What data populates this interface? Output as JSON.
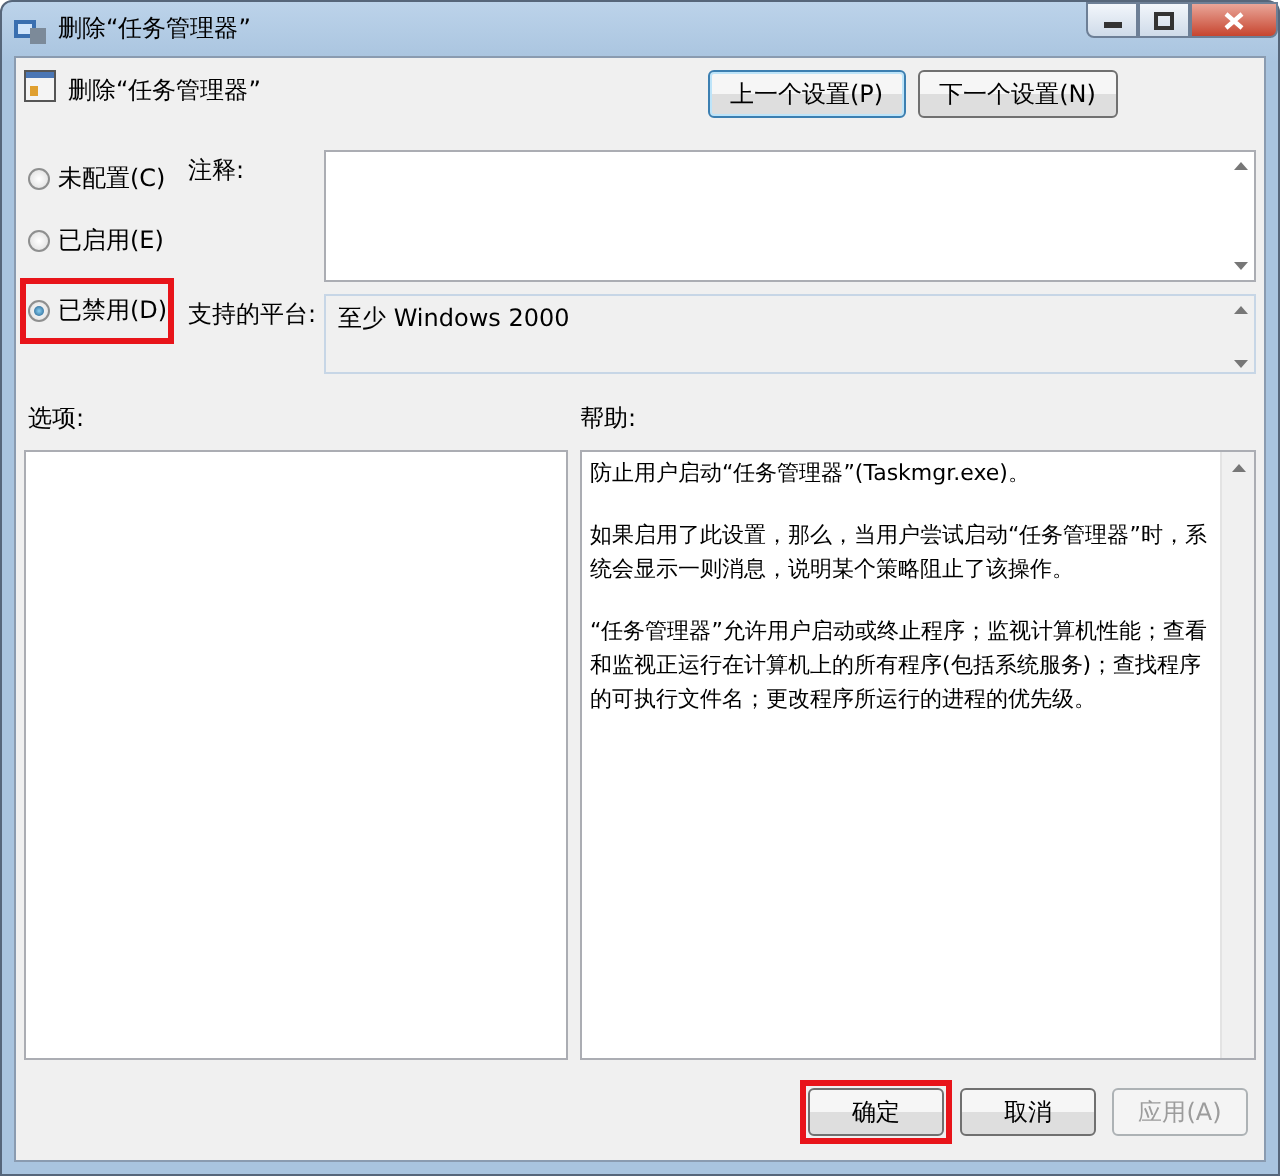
{
  "window": {
    "title": "删除“任务管理器”"
  },
  "header": {
    "title": "删除“任务管理器”"
  },
  "nav_buttons": [
    {
      "label": "上一个设置(P)",
      "focused": true
    },
    {
      "label": "下一个设置(N)",
      "focused": false
    }
  ],
  "options": [
    {
      "label": "未配置(C)",
      "selected": false,
      "highlighted": false
    },
    {
      "label": "已启用(E)",
      "selected": false,
      "highlighted": false
    },
    {
      "label": "已禁用(D)",
      "selected": true,
      "highlighted": true
    }
  ],
  "comment": {
    "label": "注释:"
  },
  "platform": {
    "label": "支持的平台:",
    "value": "至少 Windows 2000"
  },
  "options_pane": {
    "label": "选项:"
  },
  "help_pane": {
    "label": "帮助:",
    "paragraphs": [
      "防止用户启动“任务管理器”(Taskmgr.exe)。",
      "如果启用了此设置，那么，当用户尝试启动“任务管理器”时，系统会显示一则消息，说明某个策略阻止了该操作。",
      "“任务管理器”允许用户启动或终止程序；监视计算机性能；查看和监视正运行在计算机上的所有程序(包括系统服务)；查找程序的可执行文件名；更改程序所运行的进程的优先级。"
    ]
  },
  "buttons": [
    {
      "label": "确定",
      "highlighted": true,
      "disabled": false
    },
    {
      "label": "取消",
      "highlighted": false,
      "disabled": false
    },
    {
      "label": "应用(A)",
      "highlighted": false,
      "disabled": true
    }
  ]
}
